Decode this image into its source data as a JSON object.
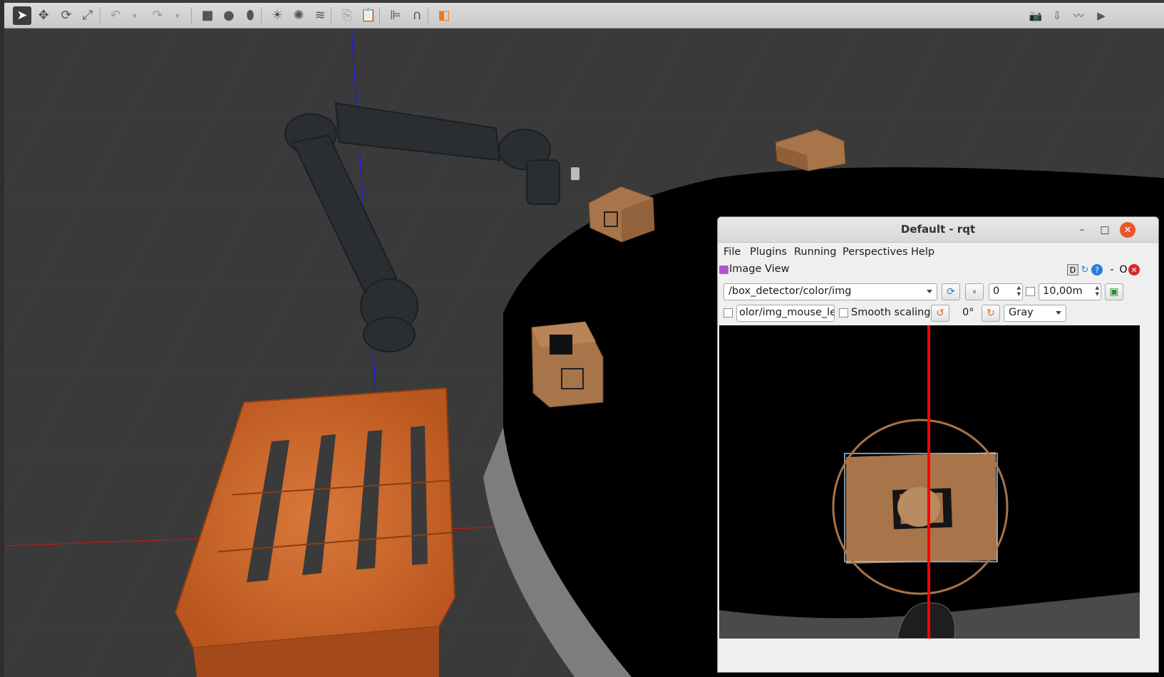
{
  "gazebo": {
    "toolbar_left": [
      {
        "name": "select-mode-icon",
        "glyph": "➤",
        "active": true
      },
      {
        "name": "translate-mode-icon",
        "glyph": "✥"
      },
      {
        "name": "rotate-mode-icon",
        "glyph": "⟳"
      },
      {
        "name": "scale-mode-icon",
        "glyph": "⤢"
      },
      {
        "name": "undo-icon",
        "glyph": "↶",
        "dim": true
      },
      {
        "name": "undo-history-icon",
        "glyph": "▾",
        "dim": true
      },
      {
        "name": "redo-icon",
        "glyph": "↷",
        "dim": true
      },
      {
        "name": "redo-history-icon",
        "glyph": "▾",
        "dim": true
      },
      {
        "name": "box-shape-icon",
        "glyph": "■"
      },
      {
        "name": "sphere-shape-icon",
        "glyph": "●"
      },
      {
        "name": "cylinder-shape-icon",
        "glyph": "⬮"
      },
      {
        "name": "point-light-icon",
        "glyph": "☀"
      },
      {
        "name": "spot-light-icon",
        "glyph": "✺"
      },
      {
        "name": "directional-light-icon",
        "glyph": "≋"
      },
      {
        "name": "copy-icon",
        "glyph": "⎘",
        "dim": true
      },
      {
        "name": "paste-icon",
        "glyph": "📋",
        "dim": true
      },
      {
        "name": "align-icon",
        "glyph": "⊫"
      },
      {
        "name": "snap-icon",
        "glyph": "∩"
      },
      {
        "name": "view-angle-icon",
        "glyph": "◧"
      }
    ],
    "toolbar_right": [
      {
        "name": "screenshot-icon",
        "glyph": "📷"
      },
      {
        "name": "log-icon",
        "glyph": "⇩"
      },
      {
        "name": "plot-icon",
        "glyph": "〰"
      },
      {
        "name": "video-record-icon",
        "glyph": "▶"
      }
    ],
    "colors": {
      "background": "#3a3a3a",
      "pallet": "#c8642a",
      "table": "#000000",
      "box": "#a8744a"
    }
  },
  "rqt": {
    "window_title": "Default - rqt",
    "minimize": "–",
    "maximize": "□",
    "close": "✕",
    "menu": [
      "File",
      "Plugins",
      "Running",
      "Perspectives",
      "Help"
    ],
    "plugin_title": "Image View",
    "plugin_controls": {
      "d": "D",
      "reload": "↻",
      "help": "?",
      "dash": "-",
      "o": "O",
      "close": "✕"
    },
    "topic": "/box_detector/color/img",
    "frame_value": "0",
    "rate_value": "10,00m",
    "mouse_topic": "olor/img_mouse_left",
    "smooth_scaling_label": "Smooth scaling",
    "rotation_label": "0°",
    "color_scheme": "Gray",
    "colors": {
      "accent": "#e9542b",
      "overlay_line": "#ff0000",
      "circle": "#a8744a",
      "bbox": "#9fc7e8"
    }
  }
}
